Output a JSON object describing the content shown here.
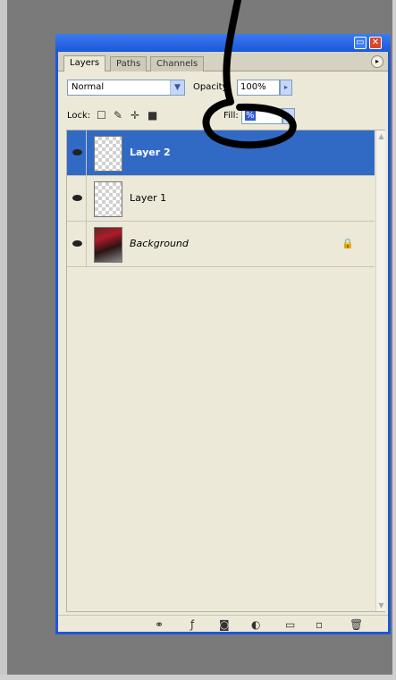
{
  "tabs": [
    "Layers",
    "Paths",
    "Channels"
  ],
  "blend_mode": "Normal",
  "opacity": {
    "label": "Opacity:",
    "value": "100%"
  },
  "lock": {
    "label": "Lock:"
  },
  "fill": {
    "label": "Fill:",
    "value": "%"
  },
  "layers": [
    {
      "name": "Layer 2",
      "selected": true
    },
    {
      "name": "Layer 1",
      "selected": false
    },
    {
      "name": "Background",
      "selected": false,
      "locked": true
    }
  ],
  "icons": {
    "panel_menu": "panel-menu-icon",
    "lock_transparent": "lock-transparent-pixels-icon",
    "lock_image": "lock-image-pixels-icon",
    "lock_position": "lock-position-icon",
    "lock_all": "lock-all-icon",
    "layer_visibility": "eye-icon",
    "background_lock": "padlock-icon",
    "bottom_bar": [
      "link-layers-icon",
      "layer-style-icon",
      "layer-mask-icon",
      "adjustment-layer-icon",
      "new-group-icon",
      "new-layer-icon",
      "trash-icon"
    ]
  },
  "colors": {
    "title_bar": "#1f56d6",
    "selection": "#316ac5",
    "panel_bg": "#ece9d8",
    "annotation": "#000000"
  }
}
